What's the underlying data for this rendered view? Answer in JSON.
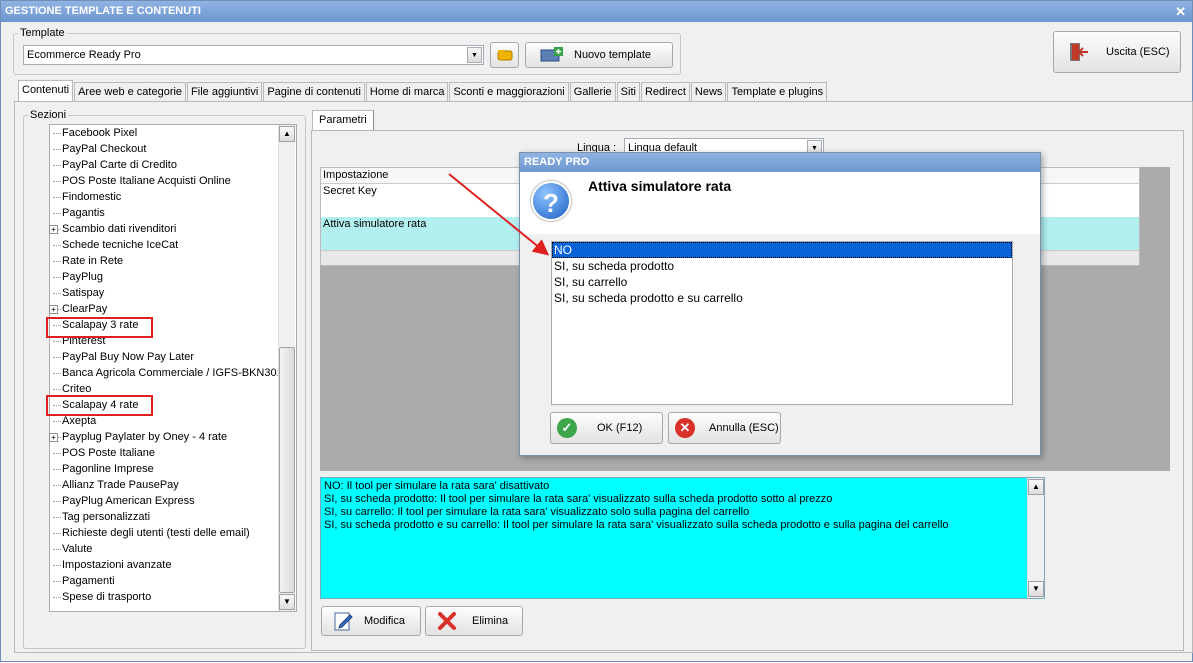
{
  "window": {
    "title": "GESTIONE TEMPLATE E CONTENUTI",
    "close_label": "✕"
  },
  "template_group": {
    "label": "Template",
    "selected": "Ecommerce Ready Pro",
    "new_button": "Nuovo template"
  },
  "exit_button": "Uscita (ESC)",
  "tabs": [
    "Contenuti",
    "Aree web e categorie",
    "File aggiuntivi",
    "Pagine di contenuti",
    "Home di marca",
    "Sconti e maggiorazioni",
    "Gallerie",
    "Siti",
    "Redirect",
    "News",
    "Template e plugins"
  ],
  "sections": {
    "label": "Sezioni",
    "items": [
      {
        "label": "Facebook Pixel",
        "expandable": false
      },
      {
        "label": "PayPal Checkout",
        "expandable": false
      },
      {
        "label": "PayPal Carte di Credito",
        "expandable": false
      },
      {
        "label": "POS Poste Italiane Acquisti Online",
        "expandable": false
      },
      {
        "label": "Findomestic",
        "expandable": false
      },
      {
        "label": "Pagantis",
        "expandable": false
      },
      {
        "label": "Scambio dati rivenditori",
        "expandable": true
      },
      {
        "label": "Schede tecniche IceCat",
        "expandable": false
      },
      {
        "label": "Rate in Rete",
        "expandable": false
      },
      {
        "label": "PayPlug",
        "expandable": false
      },
      {
        "label": "Satispay",
        "expandable": false
      },
      {
        "label": "ClearPay",
        "expandable": true
      },
      {
        "label": "Scalapay 3 rate",
        "expandable": false
      },
      {
        "label": "Pinterest",
        "expandable": false
      },
      {
        "label": "PayPal Buy Now Pay Later",
        "expandable": false
      },
      {
        "label": "Banca Agricola Commerciale / IGFS-BKN301",
        "expandable": false
      },
      {
        "label": "Criteo",
        "expandable": false
      },
      {
        "label": "Scalapay 4 rate",
        "expandable": false
      },
      {
        "label": "Axepta",
        "expandable": false
      },
      {
        "label": "Payplug Paylater by Oney - 4 rate",
        "expandable": true
      },
      {
        "label": "POS Poste Italiane",
        "expandable": false
      },
      {
        "label": "Pagonline Imprese",
        "expandable": false
      },
      {
        "label": "Allianz Trade PausePay",
        "expandable": false
      },
      {
        "label": "PayPlug American Express",
        "expandable": false
      },
      {
        "label": "Tag personalizzati",
        "expandable": false
      },
      {
        "label": "Richieste degli utenti (testi delle email)",
        "expandable": false
      },
      {
        "label": "Valute",
        "expandable": false
      },
      {
        "label": "Impostazioni avanzate",
        "expandable": false
      },
      {
        "label": "Pagamenti",
        "expandable": false
      },
      {
        "label": "Spese di trasporto",
        "expandable": false
      }
    ]
  },
  "params_tab": "Parametri",
  "lingua": {
    "label": "Lingua :",
    "value": "Lingua default"
  },
  "grid": {
    "header": "Impostazione",
    "rows": [
      "Secret Key",
      "Attiva simulatore rata"
    ]
  },
  "description": [
    "NO: Il tool per simulare la rata sara' disattivato",
    "SI, su scheda prodotto: Il tool per simulare la rata sara' visualizzato sulla scheda prodotto sotto al prezzo",
    "SI, su carrello: Il tool per simulare la rata sara' visualizzato solo sulla pagina del carrello",
    "SI, su scheda prodotto e su carrello: Il tool per simulare la rata sara' visualizzato sulla scheda prodotto e sulla pagina del carrello"
  ],
  "bottom_buttons": {
    "edit": "Modifica",
    "delete": "Elimina"
  },
  "dialog": {
    "title": "READY PRO",
    "heading": "Attiva simulatore rata",
    "options": [
      "NO",
      "SI, su scheda prodotto",
      "SI, su carrello",
      "SI, su scheda prodotto e su carrello"
    ],
    "selected_index": 0,
    "ok": "OK (F12)",
    "cancel": "Annulla (ESC)"
  },
  "colors": {
    "selection": "#0a64d8",
    "description_bg": "#00ffff",
    "highlight_row": "#b2f0f0",
    "annotation": "#e02020"
  }
}
